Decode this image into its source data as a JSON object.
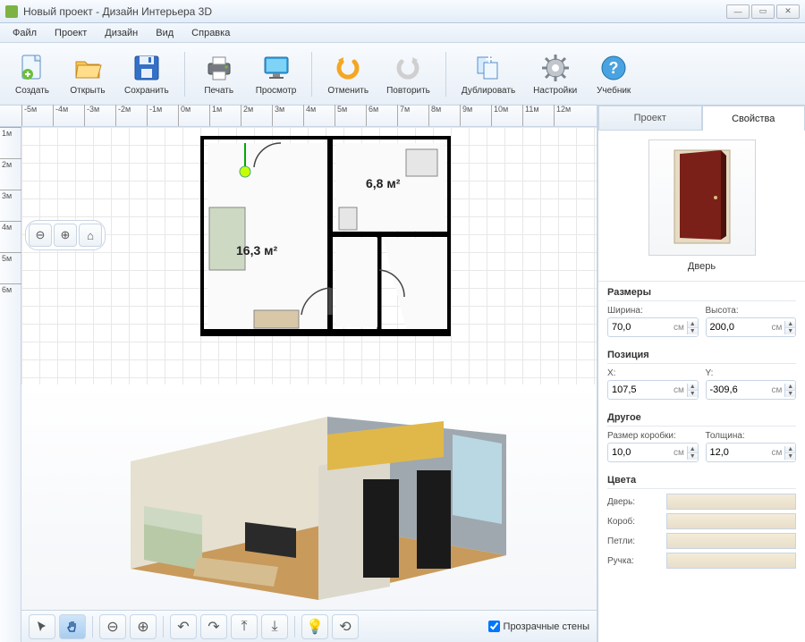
{
  "window": {
    "title": "Новый проект - Дизайн Интерьера 3D"
  },
  "menu": {
    "file": "Файл",
    "project": "Проект",
    "design": "Дизайн",
    "view": "Вид",
    "help": "Справка"
  },
  "toolbar": {
    "create": "Создать",
    "open": "Открыть",
    "save": "Сохранить",
    "print": "Печать",
    "preview": "Просмотр",
    "undo": "Отменить",
    "redo": "Повторить",
    "duplicate": "Дублировать",
    "settings": "Настройки",
    "tutorial": "Учебник"
  },
  "ruler_h": [
    "-5м",
    "-4м",
    "-3м",
    "-2м",
    "-1м",
    "0м",
    "1м",
    "2м",
    "3м",
    "4м",
    "5м",
    "6м",
    "7м",
    "8м",
    "9м",
    "10м",
    "11м",
    "12м"
  ],
  "ruler_v": [
    "1м",
    "2м",
    "3м",
    "4м",
    "5м",
    "6м"
  ],
  "floorplan": {
    "room1_area": "16,3 м²",
    "room2_area": "6,8 м²"
  },
  "transparent_walls": "Прозрачные стены",
  "tabs": {
    "project": "Проект",
    "properties": "Свойства"
  },
  "preview": {
    "label": "Дверь"
  },
  "sizes": {
    "heading": "Размеры",
    "width_label": "Ширина:",
    "width_value": "70,0",
    "width_unit": "см",
    "height_label": "Высота:",
    "height_value": "200,0",
    "height_unit": "см"
  },
  "position": {
    "heading": "Позиция",
    "x_label": "X:",
    "x_value": "107,5",
    "x_unit": "см",
    "y_label": "Y:",
    "y_value": "-309,6",
    "y_unit": "см"
  },
  "other": {
    "heading": "Другое",
    "frame_label": "Размер коробки:",
    "frame_value": "10,0",
    "frame_unit": "см",
    "thick_label": "Толщина:",
    "thick_value": "12,0",
    "thick_unit": "см"
  },
  "colors": {
    "heading": "Цвета",
    "door": "Дверь:",
    "frame": "Короб:",
    "hinge": "Петли:",
    "handle": "Ручка:"
  }
}
